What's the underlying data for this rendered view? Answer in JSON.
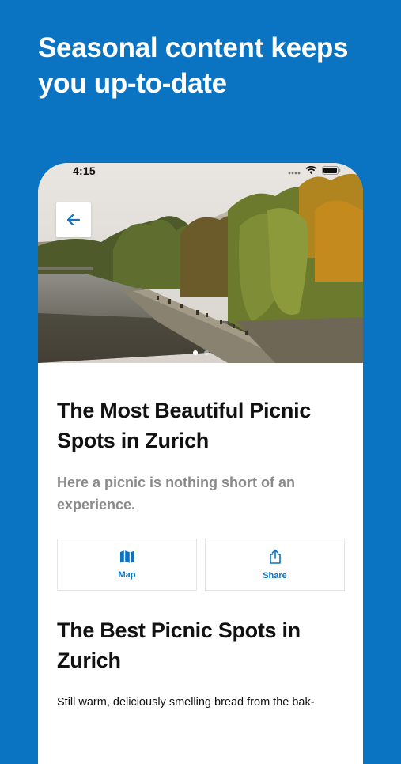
{
  "promo": {
    "headline": "Seasonal content keeps you up-to-date"
  },
  "status_bar": {
    "time": "4:15"
  },
  "hero": {
    "image_description": "",
    "page_count": 2,
    "active_page": 1
  },
  "article": {
    "title": "The Most Beautiful Picnic Spots in Zurich",
    "subtitle": "Here a picnic is nothing short of an experience.",
    "section_heading": "The Best Picnic Spots in Zurich",
    "body": "Still warm, deliciously smelling bread from the bak-"
  },
  "actions": {
    "map_label": "Map",
    "share_label": "Share"
  },
  "colors": {
    "brand": "#0b74c2",
    "text": "#111111",
    "muted": "#8a8a8a"
  },
  "icons": {
    "back": "arrow-left-icon",
    "map": "map-icon",
    "share": "share-icon",
    "signal": "signal-icon",
    "wifi": "wifi-icon",
    "battery": "battery-icon"
  }
}
